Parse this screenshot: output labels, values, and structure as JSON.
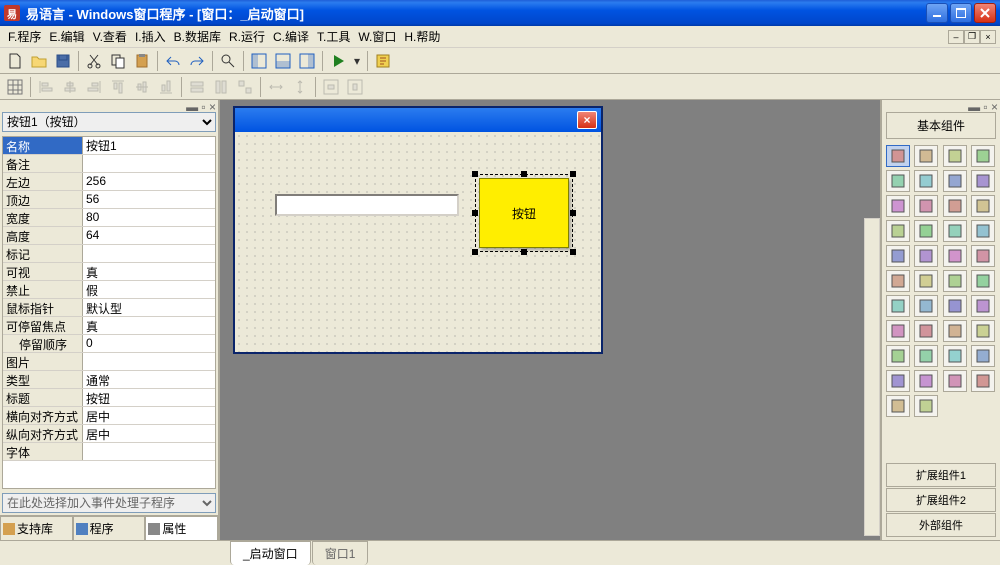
{
  "titlebar": {
    "icon_text": "易",
    "title": "易语言  -  Windows窗口程序  -  [窗口：_启动窗口]"
  },
  "menu": [
    "F.程序",
    "E.编辑",
    "V.查看",
    "I.插入",
    "B.数据库",
    "R.运行",
    "C.编译",
    "T.工具",
    "W.窗口",
    "H.帮助"
  ],
  "properties": {
    "selector": "按钮1（按钮）",
    "rows": [
      {
        "name": "名称",
        "value": "按钮1",
        "selected": true
      },
      {
        "name": "备注",
        "value": ""
      },
      {
        "name": "左边",
        "value": "256"
      },
      {
        "name": "顶边",
        "value": "56"
      },
      {
        "name": "宽度",
        "value": "80"
      },
      {
        "name": "高度",
        "value": "64"
      },
      {
        "name": "标记",
        "value": ""
      },
      {
        "name": "可视",
        "value": "真"
      },
      {
        "name": "禁止",
        "value": "假"
      },
      {
        "name": "鼠标指针",
        "value": "默认型"
      },
      {
        "name": "可停留焦点",
        "value": "真"
      },
      {
        "name": "停留顺序",
        "value": "0",
        "indent": true
      },
      {
        "name": "图片",
        "value": ""
      },
      {
        "name": "类型",
        "value": "通常"
      },
      {
        "name": "标题",
        "value": "按钮"
      },
      {
        "name": "横向对齐方式",
        "value": "居中"
      },
      {
        "name": "纵向对齐方式",
        "value": "居中"
      },
      {
        "name": "字体",
        "value": ""
      }
    ],
    "event_placeholder": "在此处选择加入事件处理子程序"
  },
  "left_tabs": [
    "支持库",
    "程序",
    "属性"
  ],
  "design": {
    "button_label": "按钮"
  },
  "right_panel": {
    "title": "基本组件",
    "tabs": [
      "扩展组件1",
      "扩展组件2",
      "外部组件"
    ]
  },
  "bottom_tabs": [
    "_启动窗口",
    "窗口1"
  ]
}
